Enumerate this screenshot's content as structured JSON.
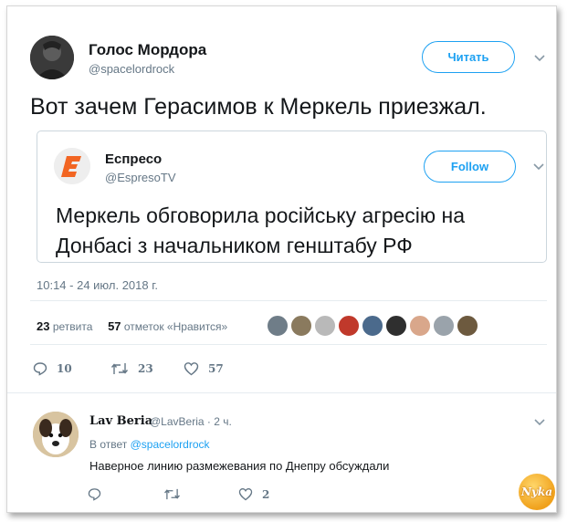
{
  "tweet": {
    "author_name": "Голос Мордора",
    "author_handle": "@spacelordrock",
    "follow_label": "Читать",
    "text": "Вот зачем Герасимов к Меркель приезжал.",
    "timestamp": "10:14 - 24 июл. 2018 г.",
    "retweets_count": "23",
    "retweets_label": "ретвита",
    "likes_count": "57",
    "likes_label": "отметок «Нравится»",
    "actions": {
      "reply_count": "10",
      "retweet_count": "23",
      "like_count": "57"
    }
  },
  "quoted": {
    "name": "Еспресо",
    "handle": "@EspresoTV",
    "follow_label": "Follow",
    "text": "Меркель обговорила російську агресію на Донбасі з начальником генштабу РФ"
  },
  "reply": {
    "name": "Lav Beria",
    "handle": "@LavBeria",
    "time": "2 ч.",
    "reply_to_prefix": "В ответ",
    "reply_to_handle": "@spacelordrock",
    "text": "Наверное линию размежевания по Днепру обсуждали",
    "actions": {
      "reply_count": "",
      "retweet_count": "",
      "like_count": "2"
    }
  },
  "watermark": "Nyka",
  "colors": {
    "accent": "#1da1f2",
    "secondary_text": "#657786",
    "primary_text": "#14171a",
    "espreso_orange": "#f26522"
  },
  "liker_avatars": [
    "#6f7d88",
    "#8a7a5e",
    "#b9b9b9",
    "#c0392b",
    "#4b6a8c",
    "#2f2f2f",
    "#d9a78b",
    "#9aa3ab",
    "#6d5a3f"
  ]
}
